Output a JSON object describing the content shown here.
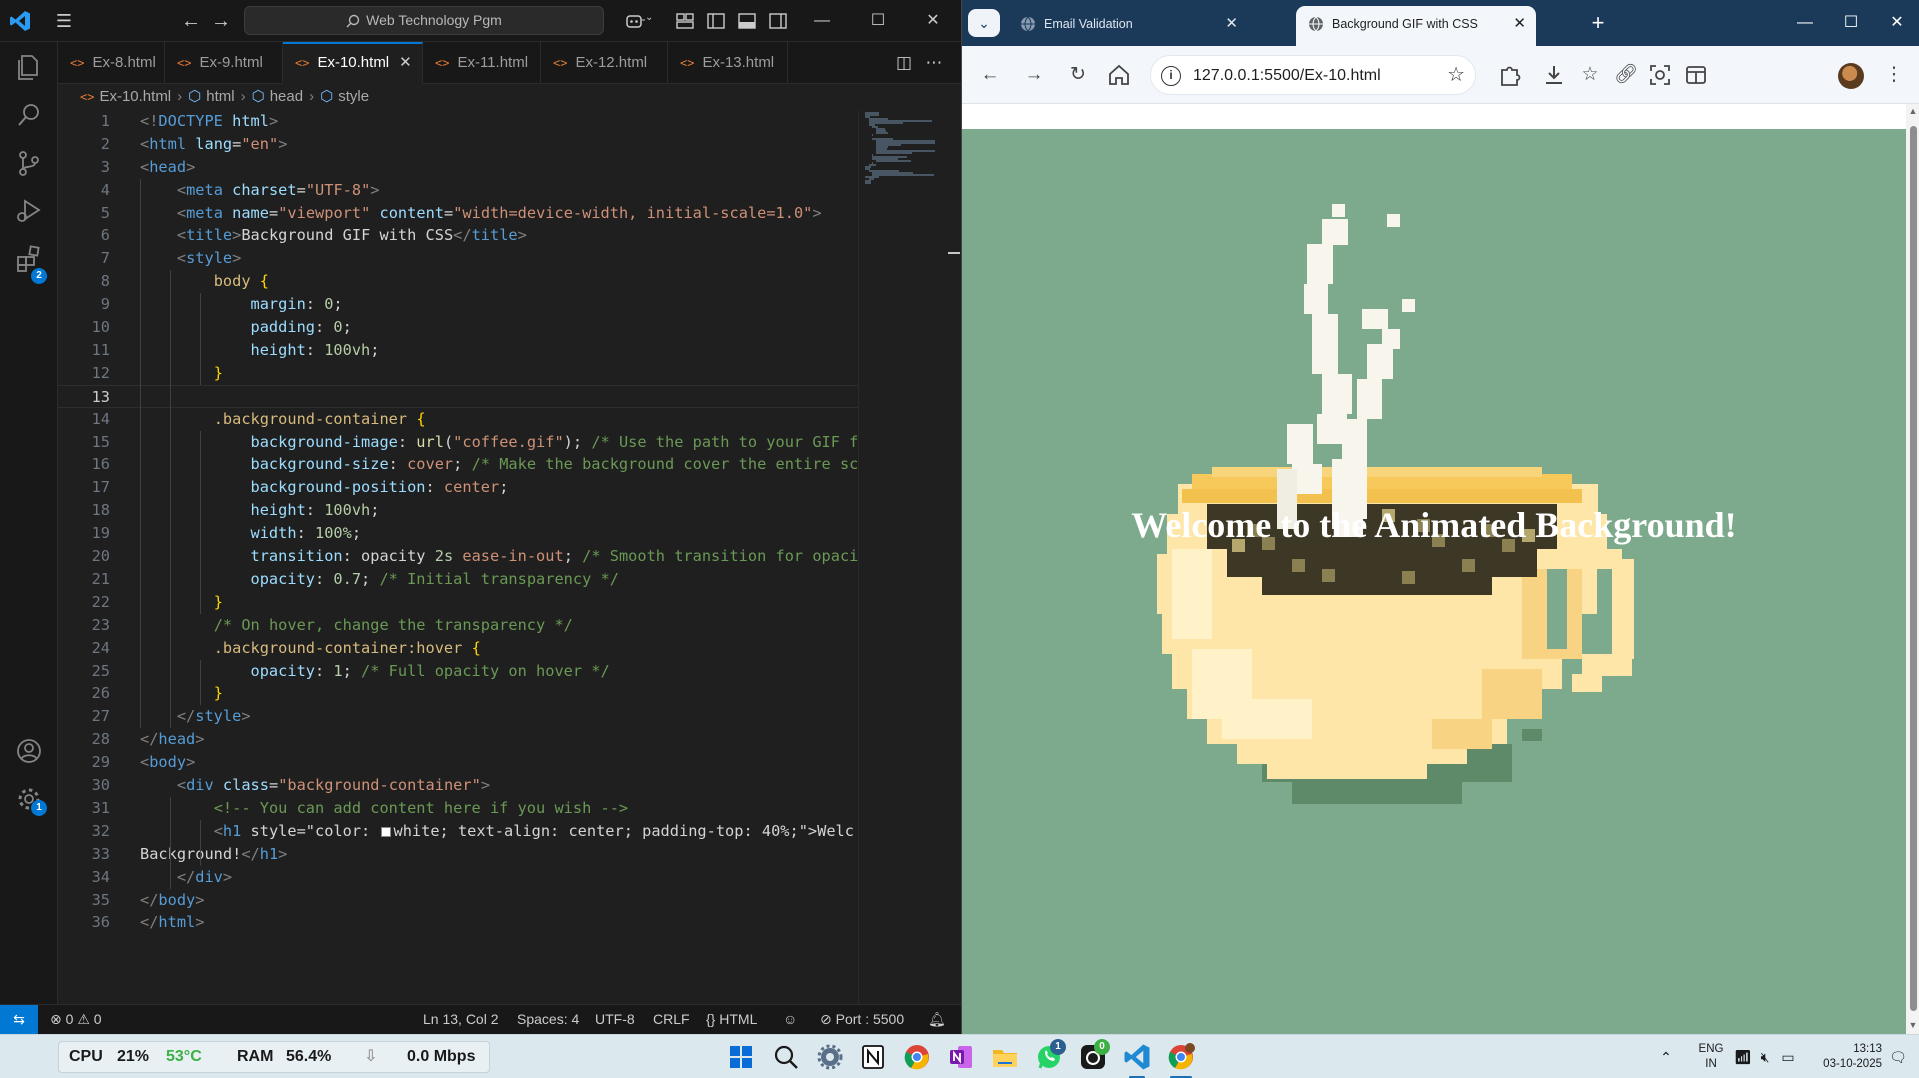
{
  "vscode": {
    "search_text": "Web Technology Pgm",
    "tabs": [
      {
        "label": "Ex-8.html",
        "active": false
      },
      {
        "label": "Ex-9.html",
        "active": false
      },
      {
        "label": "Ex-10.html",
        "active": true
      },
      {
        "label": "Ex-11.html",
        "active": false
      },
      {
        "label": "Ex-12.html",
        "active": false
      },
      {
        "label": "Ex-13.html",
        "active": false
      }
    ],
    "file_icon": "<>",
    "breadcrumb": [
      "Ex-10.html",
      "html",
      "head",
      "style"
    ],
    "extensions_badge": "2",
    "settings_badge": "1",
    "current_line": 13,
    "code_lines": [
      "<!DOCTYPE html>",
      "<html lang=\"en\">",
      "<head>",
      "    <meta charset=\"UTF-8\">",
      "    <meta name=\"viewport\" content=\"width=device-width, initial-scale=1.0\">",
      "    <title>Background GIF with CSS</title>",
      "    <style>",
      "        body {",
      "            margin: 0;",
      "            padding: 0;",
      "            height: 100vh;",
      "        }",
      "",
      "        .background-container {",
      "            background-image: url(\"coffee.gif\"); /* Use the path to your GIF f",
      "            background-size: cover; /* Make the background cover the entire sc",
      "            background-position: center;",
      "            height: 100vh;",
      "            width: 100%;",
      "            transition: opacity 2s ease-in-out; /* Smooth transition for opaci",
      "            opacity: 0.7; /* Initial transparency */",
      "        }",
      "        /* On hover, change the transparency */",
      "        .background-container:hover {",
      "            opacity: 1; /* Full opacity on hover */",
      "        }",
      "    </style>",
      "</head>",
      "<body>",
      "    <div class=\"background-container\">",
      "        <!-- You can add content here if you wish -->",
      "        <h1 style=\"color: ■white; text-align: center; padding-top: 40%;\">Welc",
      "Background!</h1>",
      "    </div>",
      "</body>",
      "</html>"
    ],
    "status": {
      "errors": "0",
      "warnings": "0",
      "position": "Ln 13, Col 2",
      "spaces": "Spaces: 4",
      "encoding": "UTF-8",
      "eol": "CRLF",
      "language": "HTML",
      "port": "Port : 5500"
    }
  },
  "browser": {
    "tabs": [
      {
        "title": "Email Validation",
        "active": false
      },
      {
        "title": "Background GIF with CSS",
        "active": true
      }
    ],
    "new_tab_label": "+",
    "url": "127.0.0.1:5500/Ex-10.html",
    "page_heading": "Welcome to the Animated Background!"
  },
  "taskbar": {
    "cpu_label": "CPU",
    "cpu_value": "21%",
    "cpu_temp": "53°C",
    "ram_label": "RAM",
    "ram_value": "56.4%",
    "net_value": "0.0 Mbps",
    "whatsapp_badge": "1",
    "github_badge": "0",
    "lang_top": "ENG",
    "lang_bottom": "IN",
    "time": "13:13",
    "date": "03-10-2025"
  },
  "colors": {
    "vscode_accent": "#0078d4",
    "page_background": "#7daa8c",
    "heading_color": "#ffffff",
    "browser_frame": "#1b3a5a"
  }
}
